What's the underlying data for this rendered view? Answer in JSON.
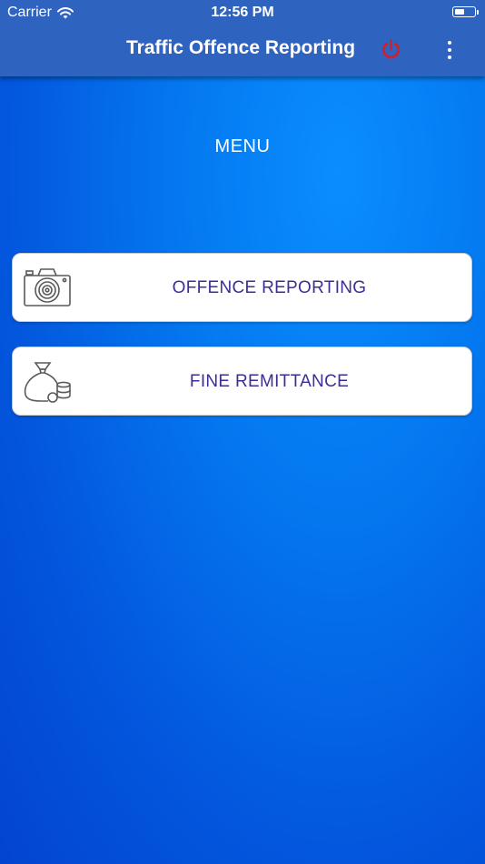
{
  "status_bar": {
    "carrier": "Carrier",
    "time": "12:56 PM",
    "wifi_icon": "wifi-icon",
    "battery_icon": "battery-icon"
  },
  "app_bar": {
    "title": "Traffic Offence Reporting",
    "power_icon": "power-icon",
    "power_color": "#d0202a",
    "more_icon": "more-vertical-icon"
  },
  "menu": {
    "title": "MENU",
    "items": [
      {
        "label": "OFFENCE REPORTING",
        "icon": "camera-icon"
      },
      {
        "label": "FINE REMITTANCE",
        "icon": "money-bag-icon"
      }
    ]
  },
  "colors": {
    "app_bar": "#2f63c0",
    "background": "#0477ef",
    "card_text": "#3f2d96",
    "card_background": "#ffffff"
  }
}
